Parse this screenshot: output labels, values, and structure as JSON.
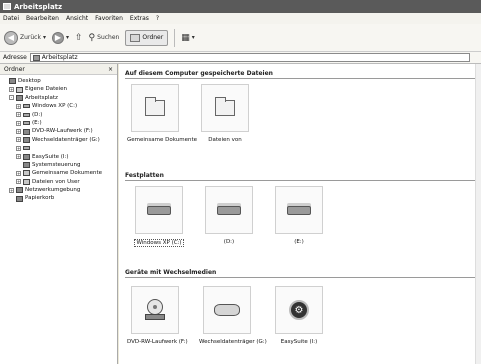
{
  "window": {
    "title": "Arbeitsplatz"
  },
  "menu": [
    "Datei",
    "Bearbeiten",
    "Ansicht",
    "Favoriten",
    "Extras",
    "?"
  ],
  "toolbar": {
    "back_label": "Zurück",
    "search_label": "Suchen",
    "folders_label": "Ordner"
  },
  "address": {
    "label": "Adresse",
    "value": "Arbeitsplatz"
  },
  "leftpane": {
    "title": "Ordner",
    "close_glyph": "×",
    "tree": [
      {
        "label": "Desktop",
        "indent": 0,
        "exp": "",
        "icon": "desktop-icon"
      },
      {
        "label": "Eigene Dateien",
        "indent": 1,
        "exp": "+",
        "icon": "folder-icon"
      },
      {
        "label": "Arbeitsplatz",
        "indent": 1,
        "exp": "-",
        "icon": "computer-icon"
      },
      {
        "label": "Windows XP (C:)",
        "indent": 2,
        "exp": "+",
        "icon": "drive-icon"
      },
      {
        "label": "(D:)",
        "indent": 2,
        "exp": "+",
        "icon": "drive-icon"
      },
      {
        "label": "(E:)",
        "indent": 2,
        "exp": "+",
        "icon": "drive-icon"
      },
      {
        "label": "DVD-RW-Laufwerk (F:)",
        "indent": 2,
        "exp": "+",
        "icon": "dvd-icon"
      },
      {
        "label": "Wechseldatenträger (G:)",
        "indent": 2,
        "exp": "+",
        "icon": "usb-icon"
      },
      {
        "label": "",
        "indent": 2,
        "exp": "+",
        "icon": "drive-icon"
      },
      {
        "label": "EasySuite (I:)",
        "indent": 2,
        "exp": "+",
        "icon": "easysuite-icon"
      },
      {
        "label": "Systemsteuerung",
        "indent": 2,
        "exp": "",
        "icon": "control-panel-icon"
      },
      {
        "label": "Gemeinsame Dokumente",
        "indent": 2,
        "exp": "+",
        "icon": "folder-icon"
      },
      {
        "label": "Dateien von User",
        "indent": 2,
        "exp": "+",
        "icon": "folder-icon"
      },
      {
        "label": "Netzwerkumgebung",
        "indent": 1,
        "exp": "+",
        "icon": "network-icon"
      },
      {
        "label": "Papierkorb",
        "indent": 1,
        "exp": "",
        "icon": "trash-icon"
      }
    ]
  },
  "sections": {
    "files_title": "Auf diesem Computer gespeicherte Dateien",
    "disks_title": "Festplatten",
    "removable_title": "Geräte mit Wechselmedien"
  },
  "files": [
    {
      "label": "Gemeinsame Dokumente"
    },
    {
      "label": "Dateien von"
    }
  ],
  "disks": [
    {
      "label": "Windows XP (C:)"
    },
    {
      "label": "(D:)"
    },
    {
      "label": "(E:)"
    }
  ],
  "removable": [
    {
      "label": "DVD-RW-Laufwerk (F:)"
    },
    {
      "label": "Wechseldatenträger (G:)"
    },
    {
      "label": "EasySuite (I:)"
    }
  ]
}
